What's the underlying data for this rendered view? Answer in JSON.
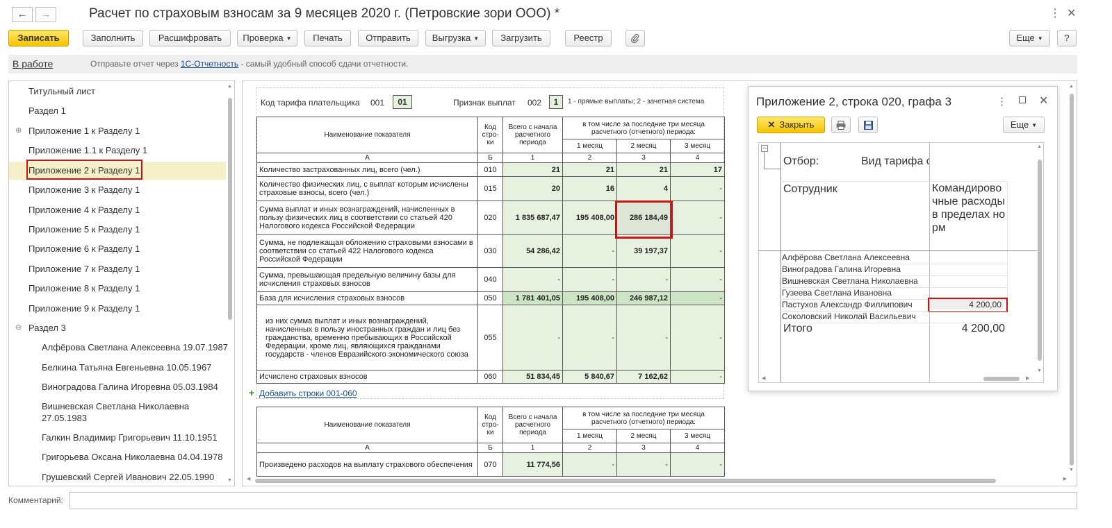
{
  "window": {
    "title": "Расчет по страховым взносам за 9 месяцев 2020 г. (Петровские зори ООО) *",
    "back_icon": "←",
    "forward_icon": "→",
    "menu_icon": "⋮",
    "close_icon": "✕"
  },
  "toolbar": {
    "save": "Записать",
    "fill": "Заполнить",
    "decode": "Расшифровать",
    "check": "Проверка",
    "print": "Печать",
    "send": "Отправить",
    "export": "Выгрузка",
    "import": "Загрузить",
    "registry": "Реестр",
    "attach_icon": "⚲",
    "more": "Еще",
    "help": "?"
  },
  "status_bar": {
    "status": "В работе",
    "message_before": "Отправьте отчет через",
    "message_link": "1С-Отчетность",
    "message_after": "- самый удобный способ сдачи отчетности."
  },
  "tree": {
    "items": [
      {
        "label": "Титульный лист"
      },
      {
        "label": "Раздел 1"
      },
      {
        "label": "Приложение 1 к Разделу 1",
        "expander": "⊕"
      },
      {
        "label": "Приложение 1.1 к Разделу 1"
      },
      {
        "label": "Приложение 2 к Разделу 1",
        "selected": true
      },
      {
        "label": "Приложение 3 к Разделу 1"
      },
      {
        "label": "Приложение 4 к Разделу 1"
      },
      {
        "label": "Приложение 5 к Разделу 1"
      },
      {
        "label": "Приложение 6 к Разделу 1"
      },
      {
        "label": "Приложение 7 к Разделу 1"
      },
      {
        "label": "Приложение 8 к Разделу 1"
      },
      {
        "label": "Приложение 9 к Разделу 1"
      },
      {
        "label": "Раздел 3",
        "expander": "⊖"
      },
      {
        "label": "Алфёрова Светлана Алексеевна 19.07.1987"
      },
      {
        "label": "Белкина Татьяна Евгеньевна 10.05.1967"
      },
      {
        "label": "Виноградова Галина Игоревна 05.03.1984"
      },
      {
        "label": "Вишневская Светлана Николаевна",
        "label2": "27.05.1983"
      },
      {
        "label": "Галкин Владимир Григорьевич 11.10.1951"
      },
      {
        "label": "Григорьева Оксана Николаевна 04.04.1978"
      },
      {
        "label": "Грушевский Сергей Иванович 22.05.1990"
      }
    ]
  },
  "report": {
    "tariff_code_label": "Код тарифа плательщика",
    "tariff_code_line": "001",
    "tariff_code_value": "01",
    "payment_sign_label": "Признак выплат",
    "payment_sign_line": "002",
    "payment_sign_value": "1",
    "payment_sign_hint": "1 - прямые выплаты; 2 - зачетная система",
    "header": {
      "name_col": "Наименование показателя",
      "code_col": "Код стро-ки",
      "total_col": "Всего с начала расчетного периода",
      "last3_col": "в том числе за последние три месяца расчетного (отчетного) периода:",
      "m1": "1 месяц",
      "m2": "2 месяц",
      "m3": "3 месяц",
      "a": "А",
      "b": "Б",
      "n1": "1",
      "n2": "2",
      "n3": "3",
      "n4": "4"
    },
    "rows": [
      {
        "name": "Количество застрахованных лиц, всего (чел.)",
        "code": "010",
        "total": "21",
        "m1": "21",
        "m2": "21",
        "m3": "17"
      },
      {
        "name": "Количество физических лиц, с выплат которым исчислены страховые взносы, всего (чел.)",
        "code": "015",
        "total": "20",
        "m1": "16",
        "m2": "4",
        "m3": "-"
      },
      {
        "name": "Сумма выплат и иных вознаграждений, начисленных в пользу физических лиц в соответствии со статьей 420 Налогового кодекса Российской Федерации",
        "code": "020",
        "total": "1 835 687,47",
        "m1": "195 408,00",
        "m2": "286 184,49",
        "m3": "-"
      },
      {
        "name": "Сумма, не подлежащая обложению страховыми взносами в соответствии со статьей 422 Налогового кодекса Российской Федерации",
        "code": "030",
        "total": "54 286,42",
        "m1": "-",
        "m2": "39 197,37",
        "m3": "-"
      },
      {
        "name": "Сумма, превышающая предельную величину базы для исчисления страховых взносов",
        "code": "040",
        "total": "-",
        "m1": "-",
        "m2": "-",
        "m3": "-"
      },
      {
        "name": "База для исчисления страховых взносов",
        "code": "050",
        "total": "1 781 401,05",
        "m1": "195 408,00",
        "m2": "246 987,12",
        "m3": "-"
      },
      {
        "name": "из них сумма выплат и иных вознаграждений, начисленных в пользу иностранных граждан и лиц без гражданства, временно пребывающих в Российской Федерации, кроме лиц, являющихся гражданами государств - членов Евразийского экономического союза",
        "code": "055",
        "total": "-",
        "m1": "-",
        "m2": "-",
        "m3": "-"
      },
      {
        "name": "Исчислено страховых взносов",
        "code": "060",
        "total": "51 834,45",
        "m1": "5 840,67",
        "m2": "7 162,62",
        "m3": "-"
      }
    ],
    "add_rows_link": "Добавить строки 001-060",
    "table2_rows": [
      {
        "name": "Произведено расходов на выплату страхового обеспечения",
        "code": "070",
        "total": "11 774,56",
        "m1": "-",
        "m2": "-",
        "m3": "-"
      }
    ]
  },
  "popup": {
    "title": "Приложение 2, строка 020, графа 3",
    "close_button": "Закрыть",
    "more": "Еще",
    "filter_label": "Отбор:",
    "filter_value": "Вид тарифа с",
    "employee_col": "Сотрудник",
    "value_col": "Командировочные расходы в пределах норм",
    "employees": [
      {
        "name": "Алфёрова Светлана Алексеевна",
        "value": ""
      },
      {
        "name": "Виноградова Галина Игоревна",
        "value": ""
      },
      {
        "name": "Вишневская Светлана Николаевна",
        "value": ""
      },
      {
        "name": "Гузеева Светлана Ивановна",
        "value": ""
      },
      {
        "name": "Пастухов Александр Филлипович",
        "value": "4 200,00"
      },
      {
        "name": "Соколовский Николай Васильевич",
        "value": ""
      }
    ],
    "total_label": "Итого",
    "total_value": "4 200,00"
  },
  "comment": {
    "label": "Комментарий:",
    "value": ""
  },
  "colors": {
    "accent_yellow": "#f6c300",
    "highlight_red": "#d11010",
    "cell_green": "#e6f1df",
    "link_blue": "#1a4b8c"
  }
}
